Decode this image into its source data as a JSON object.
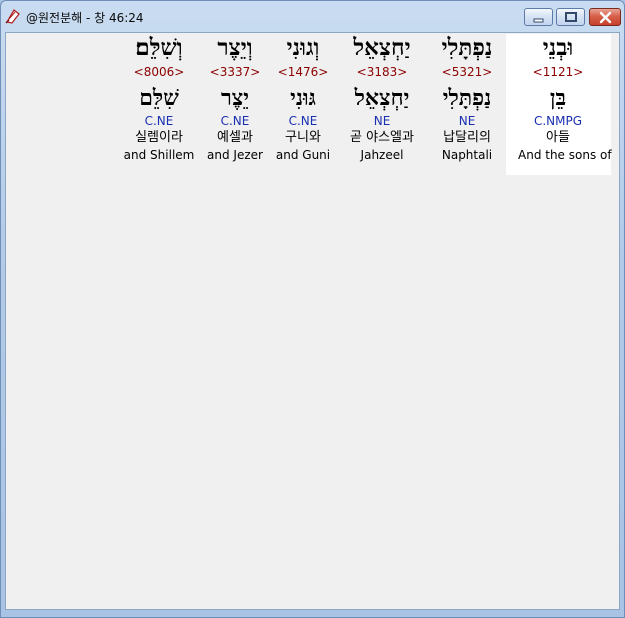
{
  "window": {
    "title": "@원전분해 - 창 46:24",
    "buttons": {
      "minimize": "minimize",
      "maximize": "maximize",
      "close": "close"
    }
  },
  "icons": {
    "app": "app-icon",
    "minimize": "minimize-icon",
    "maximize": "maximize-icon",
    "close": "close-icon"
  },
  "words": [
    {
      "hebrew": "וּבְנֵי",
      "strong": "<1121>",
      "lemma": "בֵּן",
      "parse": "C.NMPG",
      "korean": "아들",
      "english": "And the sons of"
    },
    {
      "hebrew": "נַפְתָּלִי",
      "strong": "<5321>",
      "lemma": "נַפְתָּלִי",
      "parse": "NE",
      "korean": "납달리의",
      "english": "Naphtali"
    },
    {
      "hebrew": "יַחְצְאֵל",
      "strong": "<3183>",
      "lemma": "יַחְצְאֵל",
      "parse": "NE",
      "korean": "곧 야스엘과",
      "english": "Jahzeel"
    },
    {
      "hebrew": "וְגוּנִי",
      "strong": "<1476>",
      "lemma": "גּוּנִי",
      "parse": "C.NE",
      "korean": "구니와",
      "english": "and Guni"
    },
    {
      "hebrew": "וְיֵצֶר",
      "strong": "<3337>",
      "lemma": "יֵצֶר",
      "parse": "C.NE",
      "korean": "예셀과",
      "english": "and Jezer"
    },
    {
      "hebrew": "וְשִׁלֵּם׃",
      "strong": "<8006>",
      "lemma": "שִׁלֵּם",
      "parse": "C.NE",
      "korean": "실렘이라",
      "english": "and Shillem"
    }
  ]
}
